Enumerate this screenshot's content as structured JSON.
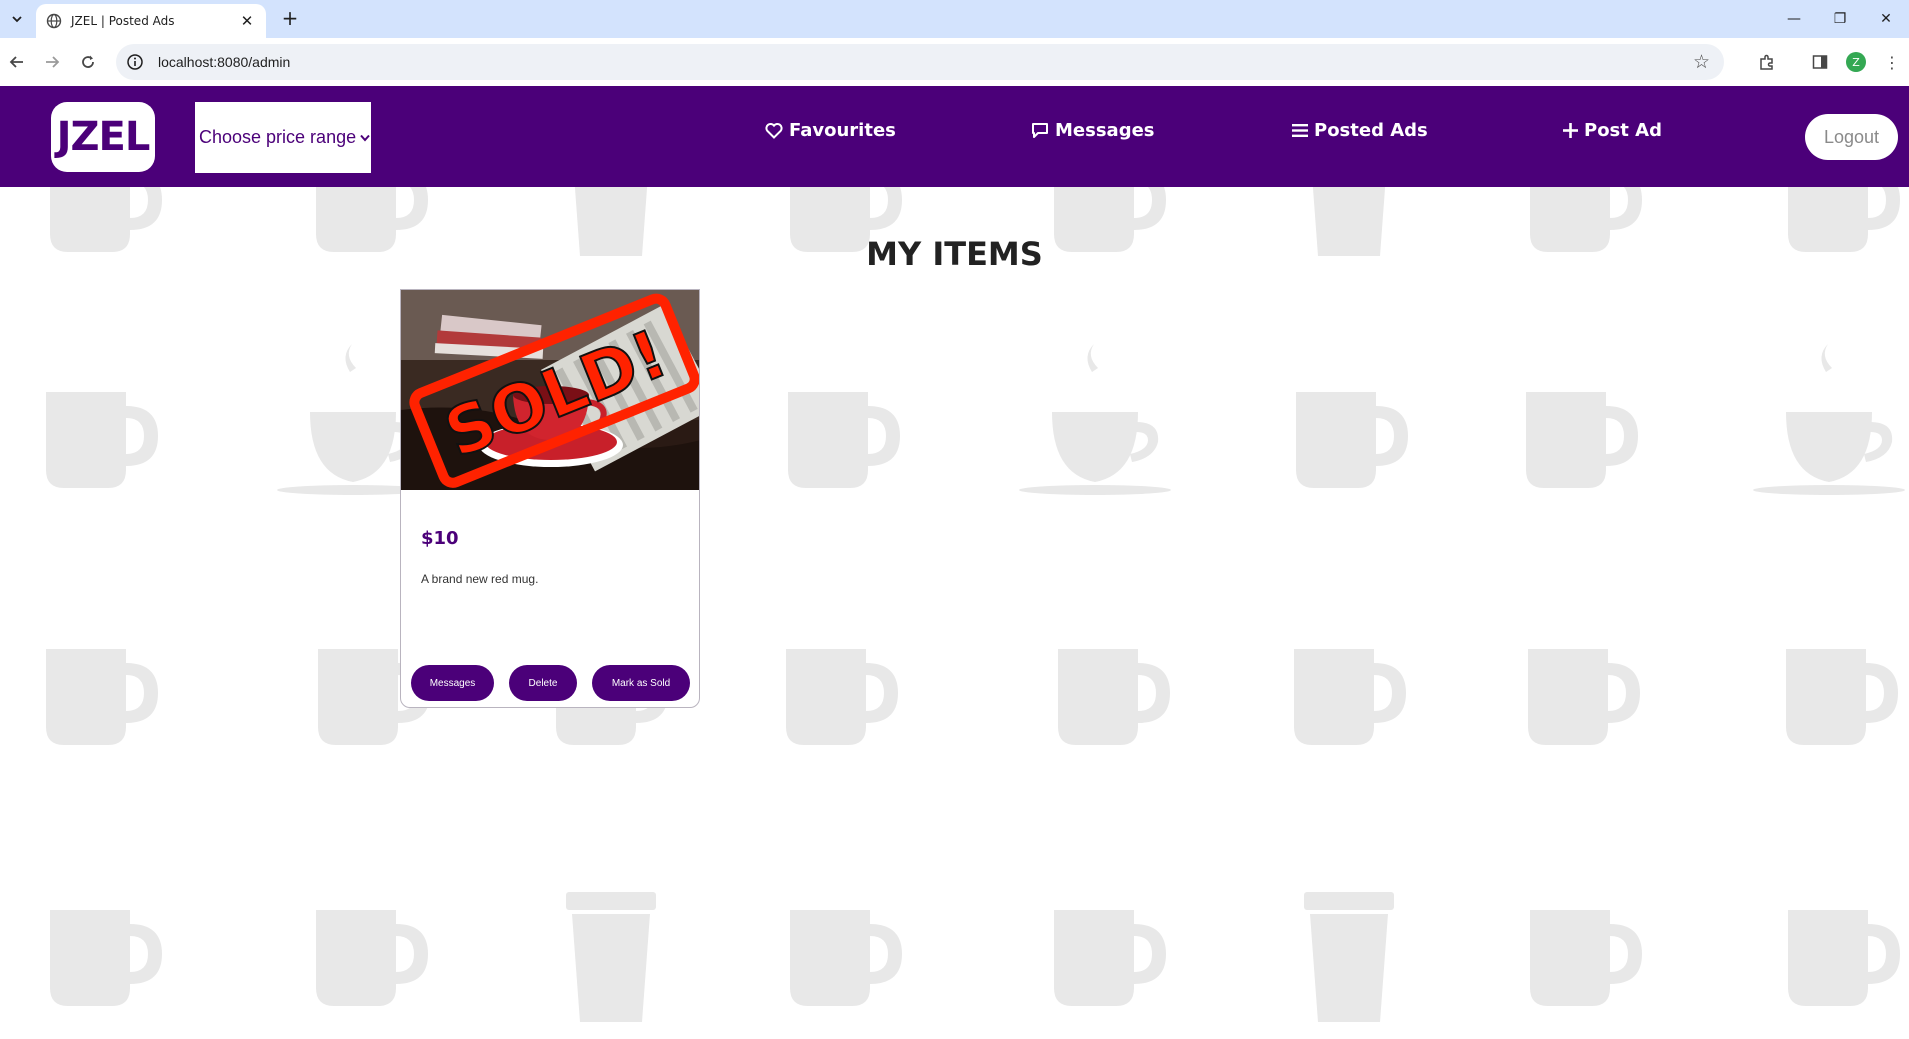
{
  "browser": {
    "tab_title": "JZEL | Posted Ads",
    "url": "localhost:8080/admin",
    "profile_initial": "Z"
  },
  "navbar": {
    "logo": "JZEL",
    "price_select": "Choose price range",
    "links": {
      "favourites": "Favourites",
      "messages": "Messages",
      "posted_ads": "Posted Ads",
      "post_ad": "Post Ad"
    },
    "logout": "Logout"
  },
  "main": {
    "heading": "MY ITEMS",
    "items": [
      {
        "stamp": "SOLD!",
        "price": "$10",
        "description": "A brand new red mug.",
        "buttons": {
          "messages": "Messages",
          "delete": "Delete",
          "mark_sold": "Mark as Sold"
        }
      }
    ]
  },
  "colors": {
    "brand": "#4b0079",
    "stamp": "#ff2200",
    "tabstrip": "#d3e3fd",
    "pattern": "#e8e8e8"
  },
  "icons": [
    "chevron-down-icon",
    "globe-icon",
    "close-icon",
    "plus-icon",
    "back-icon",
    "forward-icon",
    "reload-icon",
    "site-info-icon",
    "star-icon",
    "extensions-icon",
    "side-panel-icon",
    "kebab-menu-icon",
    "heart-icon",
    "chat-icon",
    "list-icon",
    "plus-icon"
  ]
}
